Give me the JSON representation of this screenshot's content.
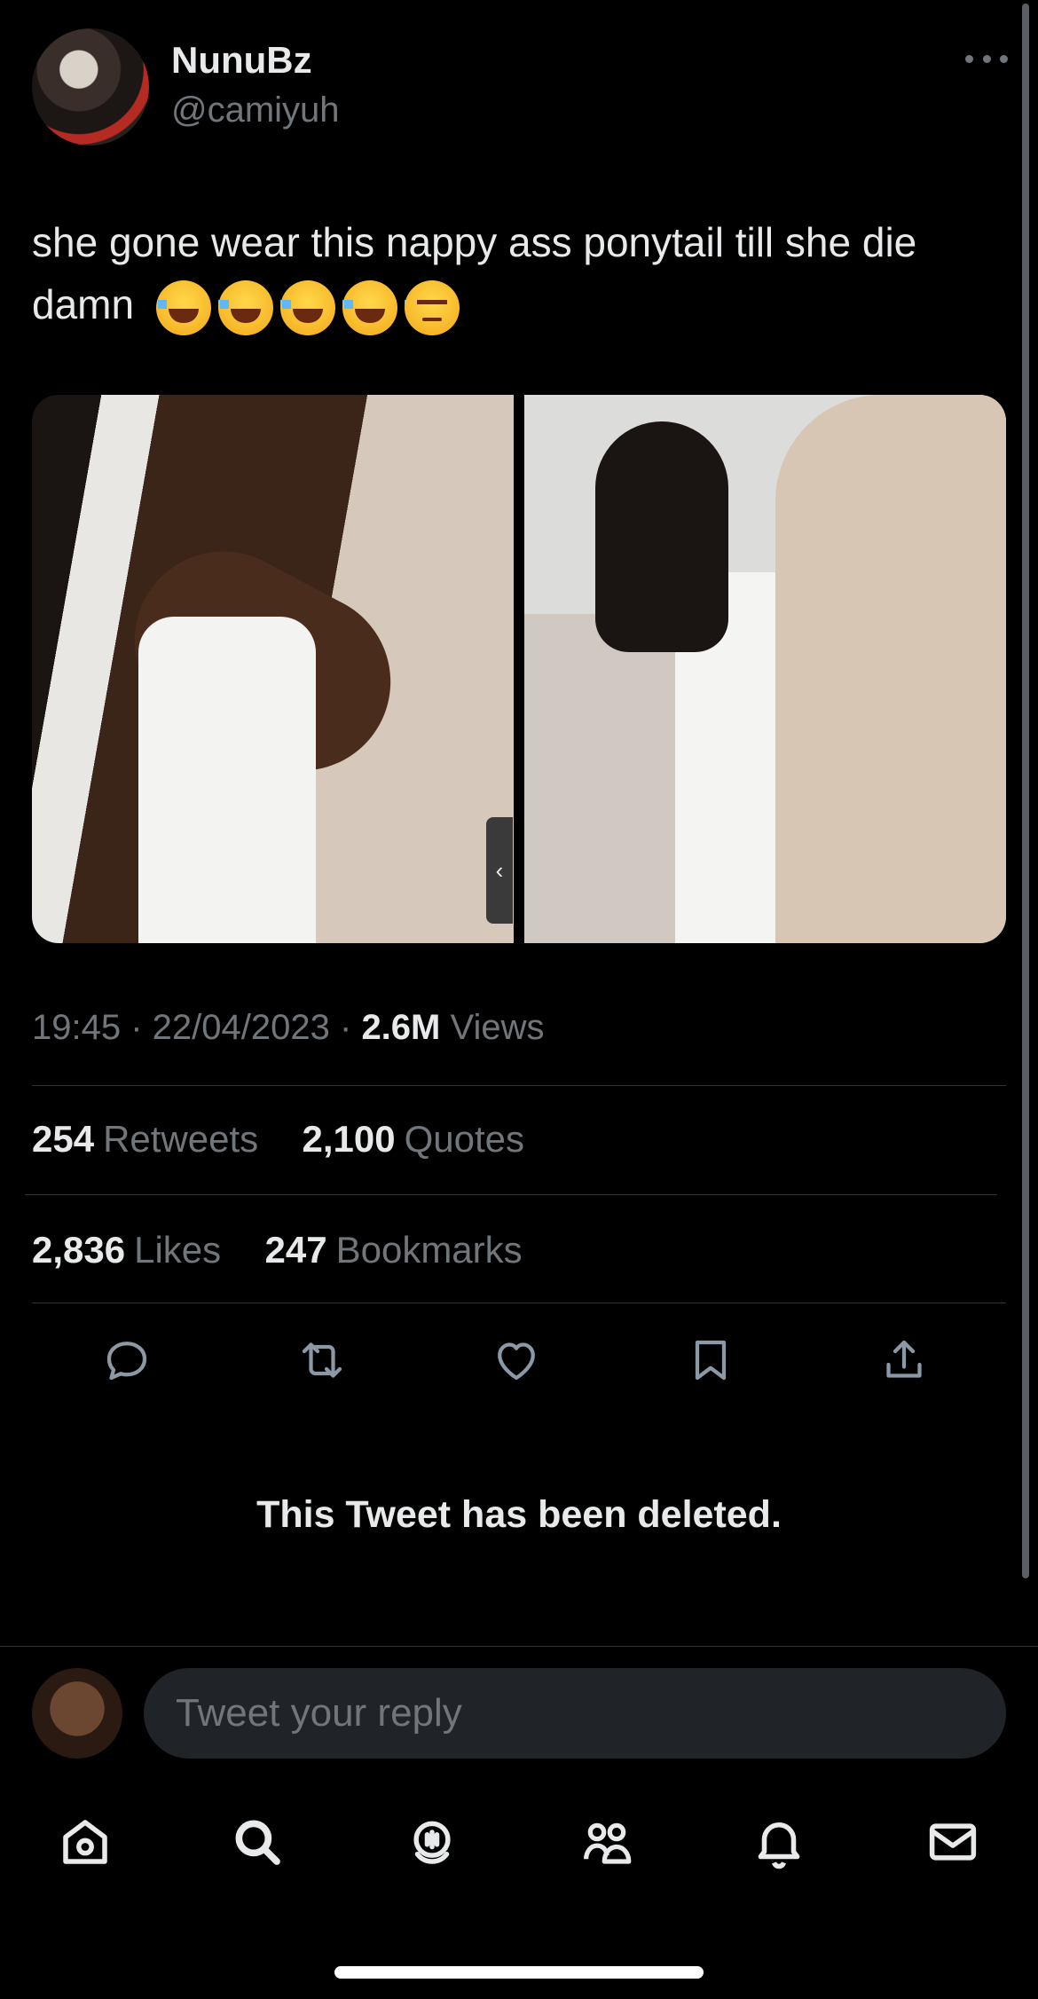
{
  "tweet": {
    "display_name": "NunuBz",
    "handle": "@camiyuh",
    "text": "she gone wear this nappy ass ponytail till she die damn",
    "emojis": [
      "face-with-tears-of-joy",
      "face-with-tears-of-joy",
      "face-with-tears-of-joy",
      "face-with-tears-of-joy",
      "unamused-face"
    ],
    "time": "19:45",
    "date": "22/04/2023",
    "views_count": "2.6M",
    "views_label": "Views",
    "retweets_count": "254",
    "retweets_label": "Retweets",
    "quotes_count": "2,100",
    "quotes_label": "Quotes",
    "likes_count": "2,836",
    "likes_label": "Likes",
    "bookmarks_count": "247",
    "bookmarks_label": "Bookmarks",
    "carousel_handle_glyph": "‹"
  },
  "actions": [
    "reply-icon",
    "retweet-icon",
    "like-icon",
    "bookmark-icon",
    "share-icon"
  ],
  "deleted_notice": "This Tweet has been deleted.",
  "reply": {
    "placeholder": "Tweet your reply"
  },
  "tabbar": [
    "home-icon",
    "search-icon",
    "spaces-icon",
    "communities-icon",
    "notifications-icon",
    "messages-icon"
  ],
  "colors": {
    "background": "#000000",
    "primary_text": "#e7e9ea",
    "secondary_text": "#71767b",
    "divider": "#2f3336",
    "input_bg": "#202327"
  }
}
